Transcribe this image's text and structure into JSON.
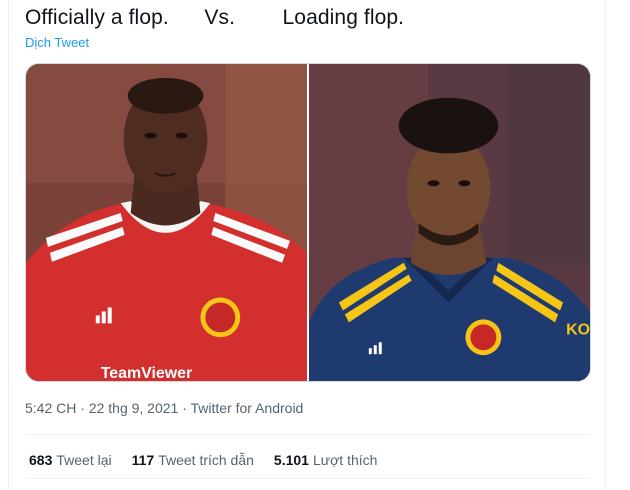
{
  "tweet": {
    "text": "Officially a flop.      Vs.        Loading flop.",
    "translate_label": "Dịch Tweet",
    "timestamp": "5:42 CH · 22 thg 9, 2021 · Twitter for Android"
  },
  "media": {
    "left_photo_overlay_text": "TeamViewer",
    "right_photo_overlay_text": "KO"
  },
  "stats": [
    {
      "count": "683",
      "label": "Tweet lại"
    },
    {
      "count": "117",
      "label": "Tweet trích dẫn"
    },
    {
      "count": "5.101",
      "label": "Lượt thích"
    }
  ],
  "colors": {
    "link": "#1d9bf0",
    "text_primary": "#0f1419",
    "text_secondary": "#536471",
    "red_kit": "#d32f2f",
    "blue_kit": "#1f3a6e",
    "yellow_trim": "#f5c518"
  }
}
